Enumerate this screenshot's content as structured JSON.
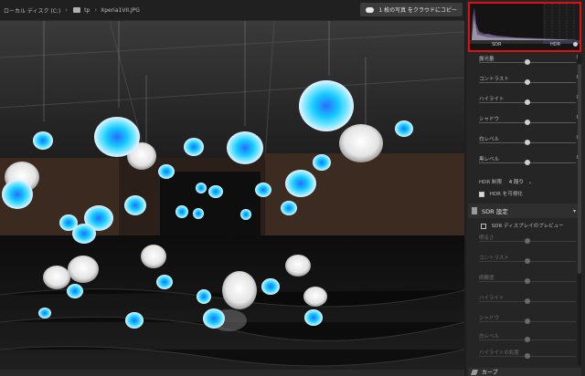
{
  "breadcrumb": {
    "drive": "ローカル ディスク (C:)",
    "folder": "tp",
    "file": "Xperia1VII.JPG"
  },
  "topbar": {
    "cloud_button": "1 枚の写真 をクラウドにコピー",
    "cloud_icon": "cloud-upload-icon"
  },
  "histogram": {
    "sdr_label": "SDR",
    "hdr_label": "HDR",
    "info_icon": "info-icon"
  },
  "basic_sliders": [
    {
      "label": "露光量",
      "value": "0",
      "level": 0.5
    },
    {
      "label": "コントラスト",
      "value": "0",
      "level": 0.5
    },
    {
      "label": "ハイライト",
      "value": "0",
      "level": 0.5
    },
    {
      "label": "シャドウ",
      "value": "0",
      "level": 0.5
    },
    {
      "label": "白レベル",
      "value": "0",
      "level": 0.5
    },
    {
      "label": "黒レベル",
      "value": "0",
      "level": 0.5
    }
  ],
  "hdr_controls": {
    "limit_label": "HDR 制限",
    "limit_value": "4 段り",
    "visualize_label": "HDR を可視化",
    "visualize_checked": true
  },
  "sdr_section": {
    "title": "SDR 設定",
    "preview_label": "SDR ディスプレイのプレビュー",
    "preview_checked": false,
    "sliders": [
      {
        "label": "明るさ",
        "value": "",
        "level": 0.5
      },
      {
        "label": "コントラスト",
        "value": "",
        "level": 0.5
      },
      {
        "label": "明瞭度",
        "value": "",
        "level": 0.5
      },
      {
        "label": "ハイライト",
        "value": "",
        "level": 0.5
      },
      {
        "label": "シャドウ",
        "value": "",
        "level": 0.5
      },
      {
        "label": "白レベル",
        "value": "",
        "level": 0.5
      },
      {
        "label": "ハイライトの彩度",
        "value": "",
        "level": 0.5
      }
    ]
  },
  "curve_tab": {
    "label": "カーブ"
  }
}
